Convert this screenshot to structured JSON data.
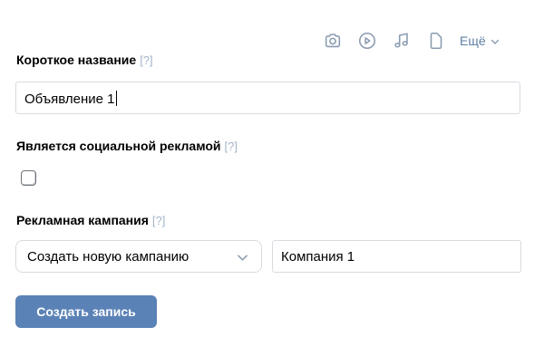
{
  "toolbar": {
    "icons": [
      "camera-icon",
      "video-icon",
      "music-icon",
      "document-icon"
    ],
    "more_label": "Ещё",
    "icon_color": "#8a9bb0",
    "accent_color": "#5d7ea5"
  },
  "short_name": {
    "label": "Короткое название",
    "hint": "[?]",
    "value": "Объявление 1"
  },
  "social_ad": {
    "label": "Является социальной рекламой",
    "hint": "[?]",
    "checked": false
  },
  "campaign": {
    "label": "Рекламная кампания",
    "hint": "[?]",
    "select_value": "Создать новую кампанию",
    "name_value": "Компания 1"
  },
  "actions": {
    "create_label": "Создать запись",
    "button_color": "#5b82b6"
  }
}
